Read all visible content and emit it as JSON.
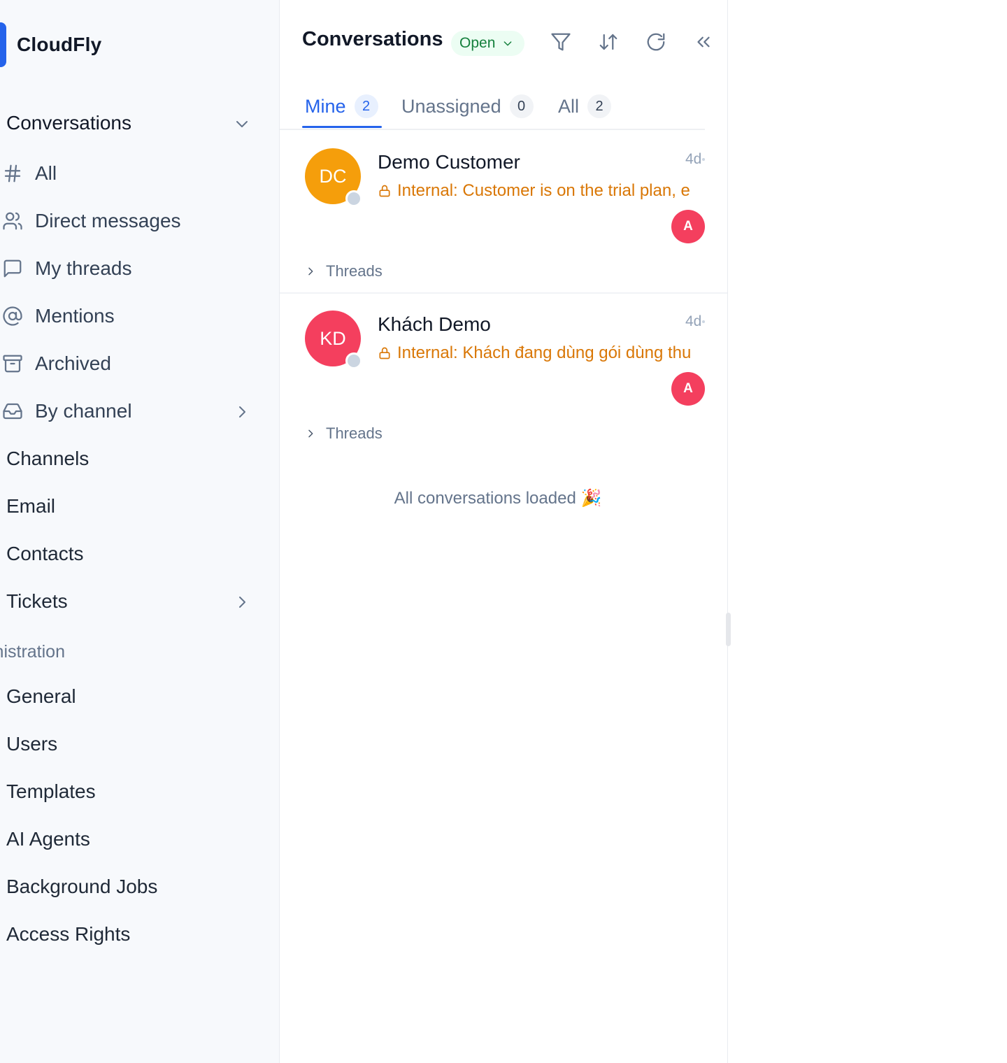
{
  "brand": {
    "name": "CloudFly",
    "color": "#2563eb"
  },
  "sidebar": {
    "section_title": "Conversations",
    "items": [
      {
        "label": "All",
        "icon": "hash-icon"
      },
      {
        "label": "Direct messages",
        "icon": "users-icon"
      },
      {
        "label": "My threads",
        "icon": "message-square-icon"
      },
      {
        "label": "Mentions",
        "icon": "at-sign-icon"
      },
      {
        "label": "Archived",
        "icon": "archive-icon"
      },
      {
        "label": "By channel",
        "icon": "inbox-icon"
      }
    ],
    "links": [
      "Channels",
      "Email",
      "Contacts",
      "Tickets"
    ],
    "admin_label": "inistration",
    "admin_links": [
      "General",
      "Users",
      "Templates",
      "AI Agents",
      "Background Jobs",
      "Access Rights"
    ]
  },
  "panel": {
    "title": "Conversations",
    "status_filter": "Open",
    "tools": [
      "filter-icon",
      "sort-icon",
      "refresh-icon",
      "collapse-icon"
    ],
    "tabs": [
      {
        "label": "Mine",
        "count": "2"
      },
      {
        "label": "Unassigned",
        "count": "0"
      },
      {
        "label": "All",
        "count": "2"
      }
    ],
    "conversations": [
      {
        "initials": "DC",
        "name": "Demo Customer",
        "time": "4d",
        "preview": "Internal: Customer is on the trial plan, e",
        "assignee": "A",
        "threads_label": "Threads",
        "avatar_color": "#f59e0b"
      },
      {
        "initials": "KD",
        "name": "Khách Demo",
        "time": "4d",
        "preview": "Internal: Khách đang dùng gói dùng thu",
        "assignee": "A",
        "threads_label": "Threads",
        "avatar_color": "#f43f5e"
      }
    ],
    "end_message": "All conversations loaded 🎉"
  }
}
